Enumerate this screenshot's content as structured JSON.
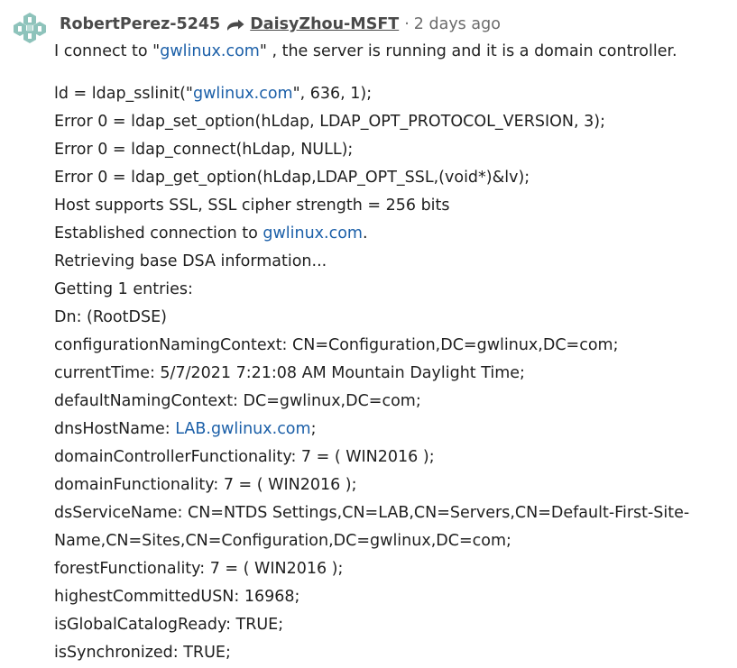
{
  "comment": {
    "author": "RobertPerez-5245",
    "recipient": "DaisyZhou-MSFT",
    "separator": "·",
    "time": "2 days ago",
    "avatar_icon": "patterned-avatar-icon",
    "reply_icon": "reply-arrow-icon",
    "colors": {
      "link": "#1b5fa8",
      "name": "#4a4a4a",
      "meta": "#6b6b6b",
      "avatar": "#7fb8b0"
    }
  },
  "body": {
    "intro": {
      "before": "I connect to \"",
      "link": "gwlinux.com",
      "after": "\" , the server is running and it is a domain controller."
    },
    "line1": {
      "before": "ld = ldap_sslinit(\"",
      "link": "gwlinux.com",
      "after": "\", 636, 1);"
    },
    "line2": "Error 0 = ldap_set_option(hLdap, LDAP_OPT_PROTOCOL_VERSION, 3);",
    "line3": "Error 0 = ldap_connect(hLdap, NULL);",
    "line4": "Error 0 = ldap_get_option(hLdap,LDAP_OPT_SSL,(void*)&lv);",
    "line5": "Host supports SSL, SSL cipher strength = 256 bits",
    "line6": {
      "before": "Established connection to ",
      "link": "gwlinux.com",
      "after": "."
    },
    "line7": "Retrieving base DSA information...",
    "line8": "Getting 1 entries:",
    "line9": "Dn: (RootDSE)",
    "line10": "configurationNamingContext: CN=Configuration,DC=gwlinux,DC=com;",
    "line11": "currentTime: 5/7/2021 7:21:08 AM Mountain Daylight Time;",
    "line12": "defaultNamingContext: DC=gwlinux,DC=com;",
    "line13": {
      "before": "dnsHostName: ",
      "link": "LAB.gwlinux.com",
      "after": ";"
    },
    "line14": "domainControllerFunctionality: 7 = ( WIN2016 );",
    "line15": "domainFunctionality: 7 = ( WIN2016 );",
    "line16a": "dsServiceName: CN=NTDS Settings,CN=LAB,CN=Servers,CN=Default-First-Site-",
    "line16b": "Name,CN=Sites,CN=Configuration,DC=gwlinux,DC=com;",
    "line17": "forestFunctionality: 7 = ( WIN2016 );",
    "line18": "highestCommittedUSN: 16968;",
    "line19": "isGlobalCatalogReady: TRUE;",
    "line20": "isSynchronized: TRUE;"
  }
}
